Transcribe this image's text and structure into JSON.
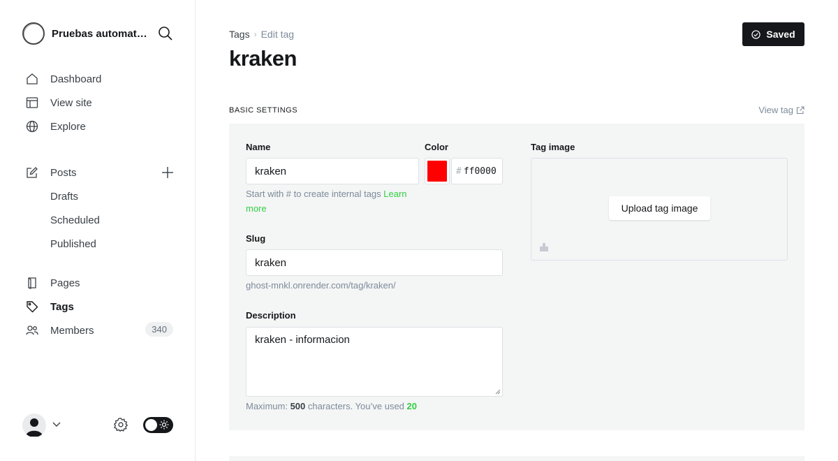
{
  "sidebar": {
    "site_title": "Pruebas automatizadas",
    "nav": [
      {
        "label": "Dashboard",
        "icon": "home-icon"
      },
      {
        "label": "View site",
        "icon": "layout-icon"
      },
      {
        "label": "Explore",
        "icon": "globe-icon"
      }
    ],
    "posts": {
      "label": "Posts",
      "icon": "edit-icon",
      "sub": [
        "Drafts",
        "Scheduled",
        "Published"
      ]
    },
    "lower": [
      {
        "label": "Pages",
        "icon": "page-icon"
      },
      {
        "label": "Tags",
        "icon": "tag-icon",
        "active": true
      },
      {
        "label": "Members",
        "icon": "members-icon",
        "badge": "340"
      }
    ]
  },
  "header": {
    "breadcrumb_parent": "Tags",
    "breadcrumb_current": "Edit tag",
    "title": "kraken",
    "save_label": "Saved"
  },
  "settings": {
    "section_title": "BASIC SETTINGS",
    "view_tag_label": "View tag",
    "name_label": "Name",
    "name_value": "kraken",
    "name_help": "Start with # to create internal tags ",
    "learn_more": "Learn more",
    "color_label": "Color",
    "color_value": "ff0000",
    "color_swatch": "#ff0000",
    "slug_label": "Slug",
    "slug_value": "kraken",
    "slug_url": "ghost-mnkl.onrender.com/tag/kraken/",
    "description_label": "Description",
    "description_value": "kraken - informacion",
    "desc_help_prefix": "Maximum: ",
    "desc_max": "500",
    "desc_help_mid": " characters. You’ve used ",
    "desc_used": "20",
    "tag_image_label": "Tag image",
    "upload_label": "Upload tag image"
  },
  "colors": {
    "accent_green": "#30cf43",
    "dark": "#15171a",
    "panel_bg": "#f4f5f5"
  }
}
